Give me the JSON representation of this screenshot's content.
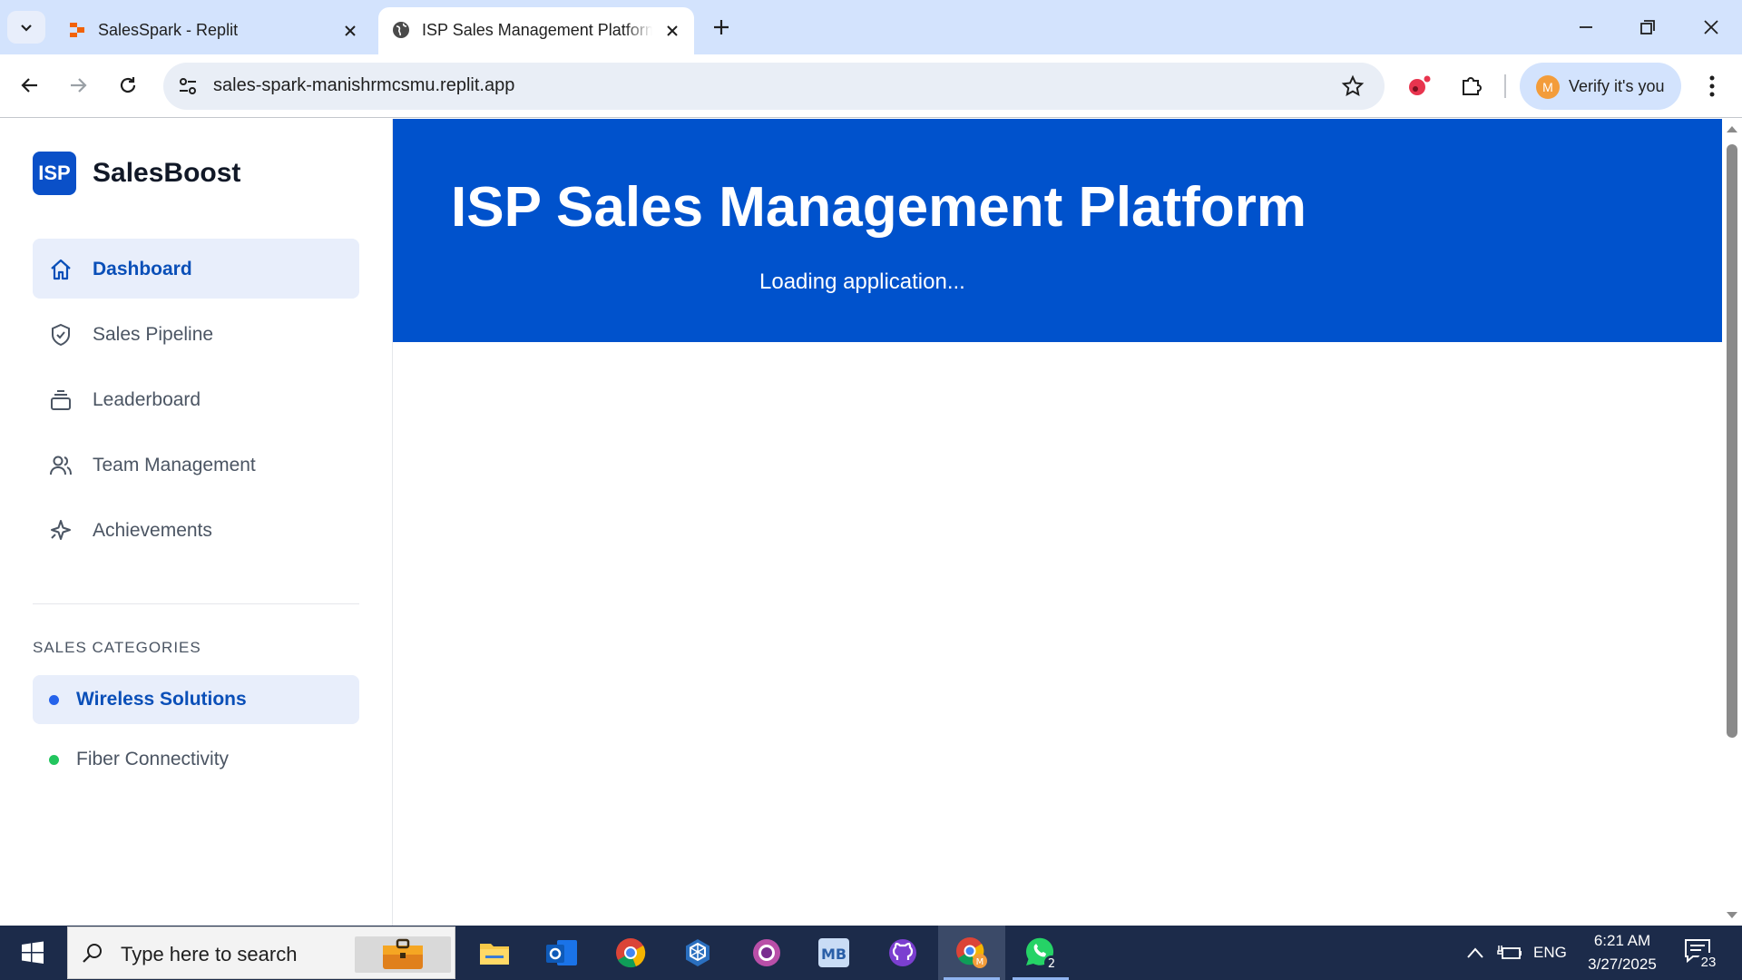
{
  "browser": {
    "tabs": [
      {
        "title": "SalesSpark - Replit",
        "active": false
      },
      {
        "title": "ISP Sales Management Platform",
        "active": true
      }
    ],
    "url": "sales-spark-manishrmcsmu.replit.app",
    "profile": {
      "initial": "M",
      "label": "Verify it's you"
    }
  },
  "sidebar": {
    "logo_text": "ISP",
    "brand": "SalesBoost",
    "nav": [
      {
        "label": "Dashboard",
        "icon": "home-icon",
        "active": true
      },
      {
        "label": "Sales Pipeline",
        "icon": "shield-check-icon",
        "active": false
      },
      {
        "label": "Leaderboard",
        "icon": "layers-icon",
        "active": false
      },
      {
        "label": "Team Management",
        "icon": "users-icon",
        "active": false
      },
      {
        "label": "Achievements",
        "icon": "sparkles-icon",
        "active": false
      }
    ],
    "section_title": "SALES CATEGORIES",
    "categories": [
      {
        "label": "Wireless Solutions",
        "color": "#2563eb",
        "active": true
      },
      {
        "label": "Fiber Connectivity",
        "color": "#22c55e",
        "active": false
      }
    ]
  },
  "main": {
    "title": "ISP Sales Management Platform",
    "loading_text": "Loading application..."
  },
  "taskbar": {
    "search_placeholder": "Type here to search",
    "apps": [
      "file-explorer-icon",
      "outlook-icon",
      "chrome-icon",
      "app-icon",
      "circle-app-icon",
      "markdown-icon",
      "github-icon",
      "chrome-profile-icon",
      "whatsapp-icon"
    ],
    "whatsapp_badge": "2",
    "language": "ENG",
    "time": "6:21 AM",
    "date": "3/27/2025",
    "notification_count": "23"
  },
  "colors": {
    "accent": "#0052cc",
    "tabstrip": "#d3e3fd",
    "taskbar": "#1c2b4a"
  }
}
